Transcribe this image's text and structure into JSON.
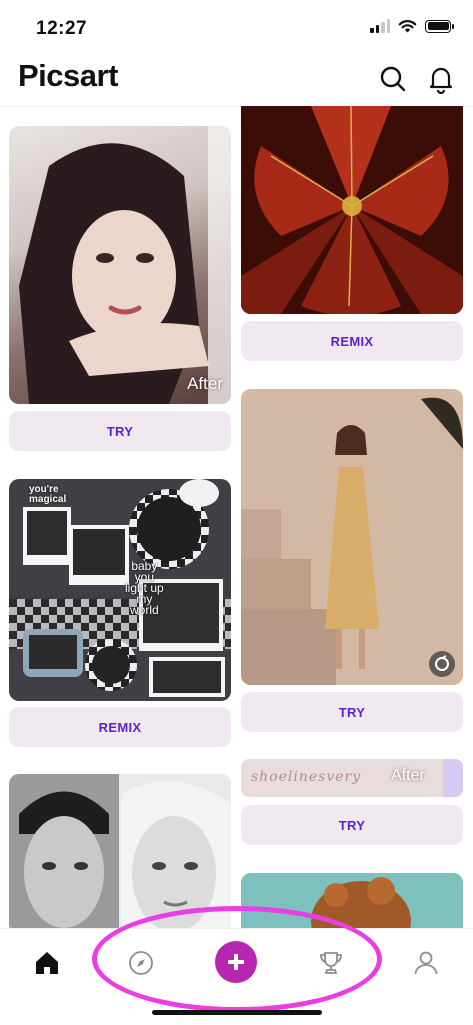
{
  "status_bar": {
    "time": "12:27"
  },
  "header": {
    "logo": "Picsart"
  },
  "feed": {
    "left": [
      {
        "label": "After",
        "button": "TRY"
      },
      {
        "collage_lines": [
          "baby",
          "you",
          "light up",
          "my",
          "world"
        ],
        "top_text": "you're magical",
        "button": "REMIX"
      },
      {
        "kind": "portrait-bw"
      }
    ],
    "right": [
      {
        "button": "REMIX"
      },
      {
        "button": "TRY"
      },
      {
        "strip_text": "shoelinesvery",
        "label": "After",
        "button": "TRY"
      },
      {
        "kind": "curly-hair-photo"
      }
    ]
  },
  "nav": {
    "items": [
      {
        "icon": "home-icon"
      },
      {
        "icon": "compass-icon"
      },
      {
        "icon": "plus-icon"
      },
      {
        "icon": "trophy-icon"
      },
      {
        "icon": "profile-icon"
      }
    ],
    "active": "home-icon",
    "accent_color": "#b726b0",
    "highlight_color": "#ea3de4"
  }
}
